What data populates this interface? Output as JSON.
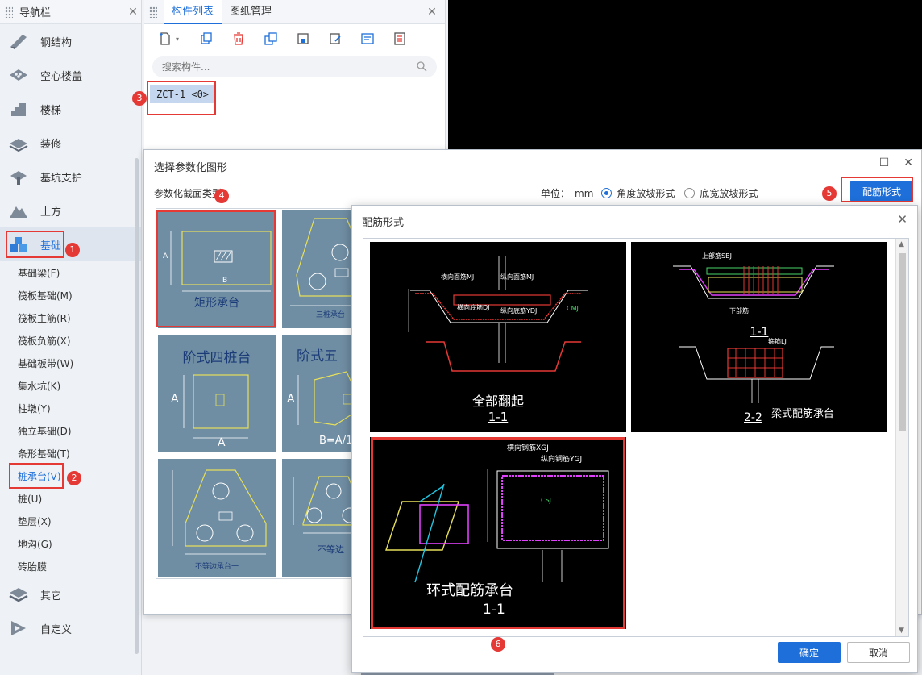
{
  "nav": {
    "title": "导航栏",
    "categories_top": [
      {
        "label": "钢结构",
        "icon": "steel-icon"
      },
      {
        "label": "空心楼盖",
        "icon": "hollow-floor-icon"
      },
      {
        "label": "楼梯",
        "icon": "stairs-icon"
      },
      {
        "label": "装修",
        "icon": "decoration-icon"
      },
      {
        "label": "基坑支护",
        "icon": "pit-support-icon"
      },
      {
        "label": "土方",
        "icon": "earthwork-icon"
      },
      {
        "label": "基础",
        "icon": "foundation-icon"
      }
    ],
    "subitems": [
      "基础梁(F)",
      "筏板基础(M)",
      "筏板主筋(R)",
      "筏板负筋(X)",
      "基础板带(W)",
      "集水坑(K)",
      "柱墩(Y)",
      "独立基础(D)",
      "条形基础(T)",
      "桩承台(V)",
      "桩(U)",
      "垫层(X)",
      "地沟(G)",
      "砖胎膜"
    ],
    "categories_bottom": [
      {
        "label": "其它",
        "icon": "other-icon"
      },
      {
        "label": "自定义",
        "icon": "custom-icon"
      }
    ]
  },
  "component_panel": {
    "tabs": [
      "构件列表",
      "图纸管理"
    ],
    "search_placeholder": "搜索构件...",
    "item": "ZCT-1 <0>"
  },
  "param_dialog": {
    "title": "选择参数化图形",
    "section_label": "参数化截面类型",
    "unit_label": "单位：",
    "unit_value": "mm",
    "radio_angle": "角度放坡形式",
    "radio_width": "底宽放坡形式",
    "rebar_button": "配筋形式",
    "cells": [
      "矩形承台",
      "三桩承台",
      "阶式四桩台",
      "阶式五",
      "不等边承台一",
      "不等边"
    ],
    "dim_labels": {
      "a": "A",
      "b": "B",
      "b_eq": "B=A/1"
    }
  },
  "rebar_dialog": {
    "title": "配筋形式",
    "options": [
      {
        "caption": "全部翻起",
        "section": "1-1",
        "label_h": "横向面筋MJ",
        "label_v": "纵向面筋MJ",
        "label_bot": "横向底筋DJ",
        "label_bot2": "纵向底筋YDJ",
        "side": "CMJ"
      },
      {
        "caption": "梁式配筋承台",
        "section1": "1-1",
        "section2": "2-2",
        "label_top": "上部筋SBJ",
        "label_bot": "下部筋",
        "label_tie": "箍筋LJ"
      },
      {
        "caption": "环式配筋承台",
        "section": "1-1",
        "label_h": "横向钢筋XGJ",
        "label_v": "纵向钢筋YGJ",
        "side": "CSJ"
      }
    ],
    "ok": "确定",
    "cancel": "取消"
  },
  "badges": [
    "1",
    "2",
    "3",
    "4",
    "5",
    "6"
  ],
  "colors": {
    "accent": "#1e6fd9",
    "highlight": "#e53935"
  }
}
